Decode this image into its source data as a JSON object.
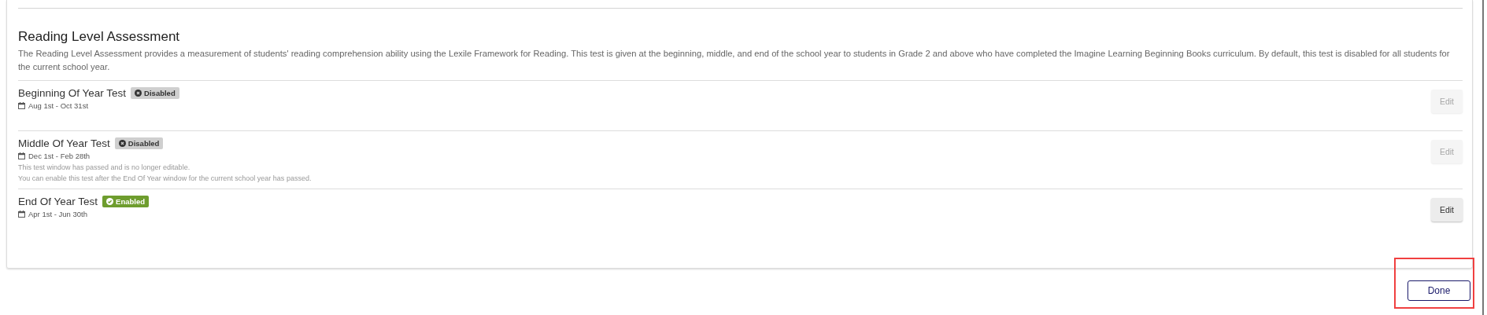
{
  "section": {
    "title": "Reading Level Assessment",
    "description": "The Reading Level Assessment provides a measurement of students' reading comprehension ability using the Lexile Framework for Reading. This test is given at the beginning, middle, and end of the school year to students in Grade 2 and above who have completed the Imagine Learning Beginning Books curriculum. By default, this test is disabled for all students for the current school year."
  },
  "tests": [
    {
      "name": "Beginning Of Year Test",
      "status": "Disabled",
      "enabled": false,
      "dates": "Aug 1st - Oct 31st",
      "edit": {
        "label": "Edit",
        "disabled": true
      }
    },
    {
      "name": "Middle Of Year Test",
      "status": "Disabled",
      "enabled": false,
      "dates": "Dec 1st - Feb 28th",
      "notes": [
        "This test window has passed and is no longer editable.",
        "You can enable this test after the End Of Year window for the current school year has passed."
      ],
      "edit": {
        "label": "Edit",
        "disabled": true
      }
    },
    {
      "name": "End Of Year Test",
      "status": "Enabled",
      "enabled": true,
      "dates": "Apr 1st - Jun 30th",
      "edit": {
        "label": "Edit",
        "disabled": false
      }
    }
  ],
  "done_button": {
    "label": "Done",
    "highlighted": true
  }
}
